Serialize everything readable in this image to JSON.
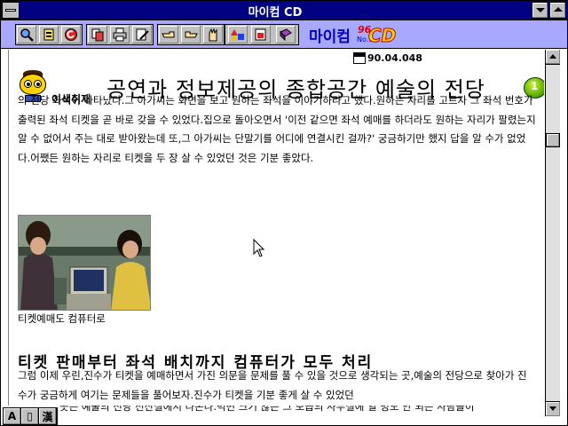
{
  "window": {
    "title": "마이컴 CD"
  },
  "toolbar": {
    "icons": [
      "zoom-icon",
      "print-icon",
      "back-icon",
      "copy-icon",
      "printer-icon",
      "edit-icon",
      "hand-icon",
      "hand-point-icon",
      "hand-stop-icon",
      "shapes-icon",
      "bookmark-icon",
      "book-icon"
    ],
    "brand": {
      "name": "마이컴",
      "year": "96",
      "rank": "No.1",
      "cd": "CD"
    }
  },
  "article": {
    "issue": "90.04.048",
    "author": "이색취재",
    "headline": "공연과 정보제공의 종합공간 예술의 전당",
    "next_label": "1",
    "paragraph1": "의 전당 좌석이 나타났다.그 아가씨는 화면을 보고 원하는 좌석을 이야기하라고 했다.원하는 자리를 고르자 그 좌석 번호가 출력된 좌석 티켓을 곧 바로 갖을 수 있었다.집으로 돌아오면서 '이전 같으면 좌석 예매를 하더라도 원하는 자리가 팔렸는지 알 수 없어서 주는 대로 받아왔는데 또,그 아가씨는 단말기를 어디에 연결시킨 걸까?' 궁금하기만 했지 답을 알 수가 없었다.어쨌든 원하는 자리로 티켓을 두 장 살 수 있었던 것은 기분 좋았다.",
    "photo_caption": "티켓예매도 컴퓨터로",
    "subheading": "티켓 판매부터 좌석 배치까지 컴퓨터가 모두 처리",
    "paragraph2": "그럼 이제 우린,진수가 티켓을 예매하면서 가진 의문을 문제를 풀 수 있을 것으로 생각되는 곳,예술의 전당으로 찾아가 진수가 궁금하게 여기는 문제들을 풀어보자.진수가 티켓을 기분 좋게 살 수 있었던",
    "paragraph3": "곳은 예술의 전당 전산실에서 나온다.벽면 크기 않은 그 모습의 사무실에 열 명도 안 되는 사람들이"
  },
  "ime": {
    "mode1": "A",
    "mode2": "▯",
    "mode3": "漢"
  }
}
